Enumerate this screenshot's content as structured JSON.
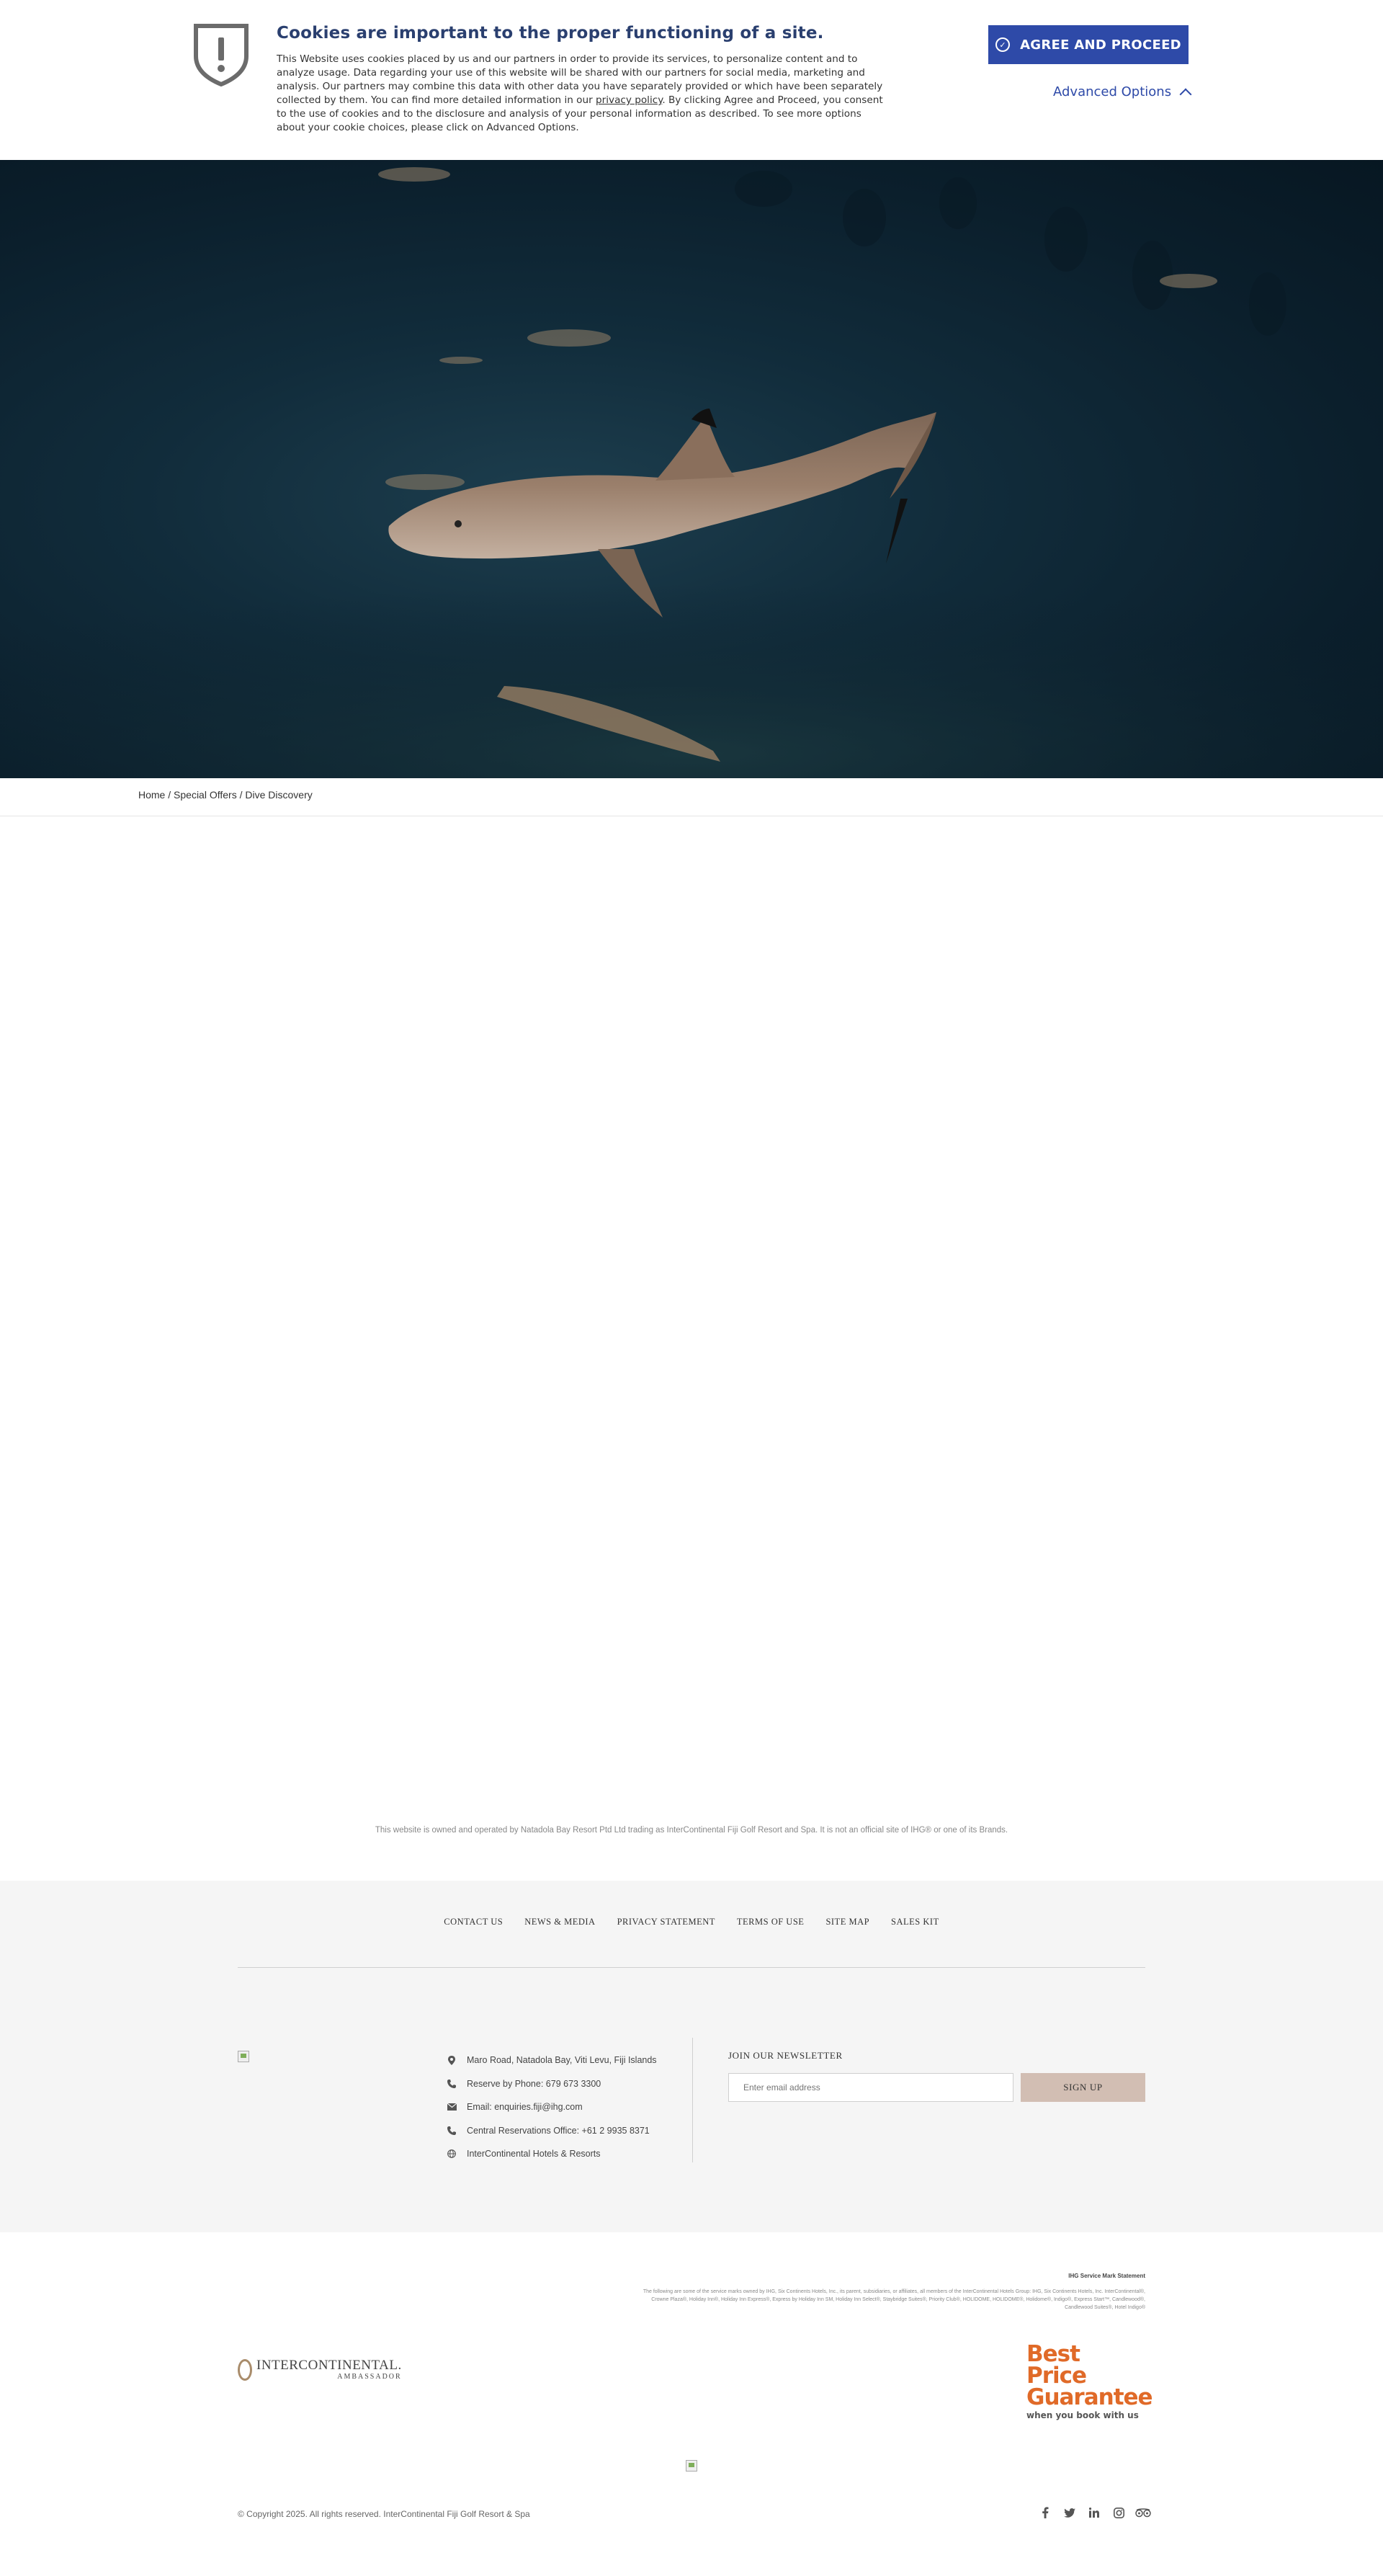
{
  "cookie": {
    "title": "Cookies are important to the proper functioning of a site.",
    "text_before_link": "This Website uses cookies placed by us and our partners in order to provide its services, to personalize content and to analyze usage. Data regarding your use of this website will be shared with our partners for social media, marketing and analysis. Our partners may combine this data with other data you have separately provided or which have been separately collected by them. You can find more detailed information in our ",
    "link_text": "privacy policy",
    "text_after_link": ". By clicking Agree and Proceed, you consent to the use of cookies and to the disclosure and analysis of your personal information as described. To see more options about your cookie choices, please click on Advanced Options.",
    "agree_label": "AGREE AND PROCEED",
    "advanced_label": "Advanced Options",
    "accent_color": "#2e4aa8"
  },
  "breadcrumb": [
    "Home",
    "Special Offers",
    "Dive Discovery"
  ],
  "owner_note": "This website is owned and operated by Natadola Bay Resort Ptd Ltd trading as InterContinental Fiji Golf Resort and Spa. It is not an official site of IHG® or one of its Brands.",
  "footer_nav": [
    "CONTACT US",
    "NEWS & MEDIA",
    "PRIVACY STATEMENT",
    "TERMS OF USE",
    "SITE MAP",
    "SALES KIT"
  ],
  "contact": [
    {
      "icon": "location-pin-icon",
      "text": "Maro Road, Natadola Bay, Viti Levu, Fiji Islands"
    },
    {
      "icon": "phone-icon",
      "text": "Reserve by Phone: 679 673 3300"
    },
    {
      "icon": "envelope-icon",
      "text": "Email: enquiries.fiji@ihg.com"
    },
    {
      "icon": "phone-icon",
      "text": "Central Reservations Office: +61 2 9935 8371"
    },
    {
      "icon": "globe-icon",
      "text": "InterContinental Hotels & Resorts"
    }
  ],
  "newsletter": {
    "title": "JOIN OUR NEWSLETTER",
    "placeholder": "Enter email address",
    "button": "SIGN UP"
  },
  "service_mark": {
    "title": "IHG Service Mark Statement",
    "body": "The following are some of the service marks owned by IHG, Six Continents Hotels, Inc., its parent, subsidiaries, or affiliates, all members of the InterContinental Hotels Group: IHG, Six Continents Hotels, Inc. InterContinental®, Crowne Plaza®, Holiday Inn®, Holiday Inn Express®, Express by Holiday Inn SM, Holiday Inn Select®, Staybridge Suites®, Priority Club®, HOLIDOME, HOLIDOME®, Holidome®, Indigo®, Express Start™, Candlewood®, Candlewood Suites®, Hotel Indigo®"
  },
  "logo": {
    "name": "INTERCONTINENTAL.",
    "sub": "AMBASSADOR"
  },
  "best_price": {
    "line1": "Best Price",
    "line2": "Guarantee",
    "sub": "when you book with us",
    "color": "#e06a28"
  },
  "copyright": "© Copyright 2025. All rights reserved. InterContinental Fiji Golf Resort & Spa",
  "socials": [
    "facebook-icon",
    "twitter-icon",
    "linkedin-icon",
    "instagram-icon",
    "tripadvisor-icon"
  ]
}
